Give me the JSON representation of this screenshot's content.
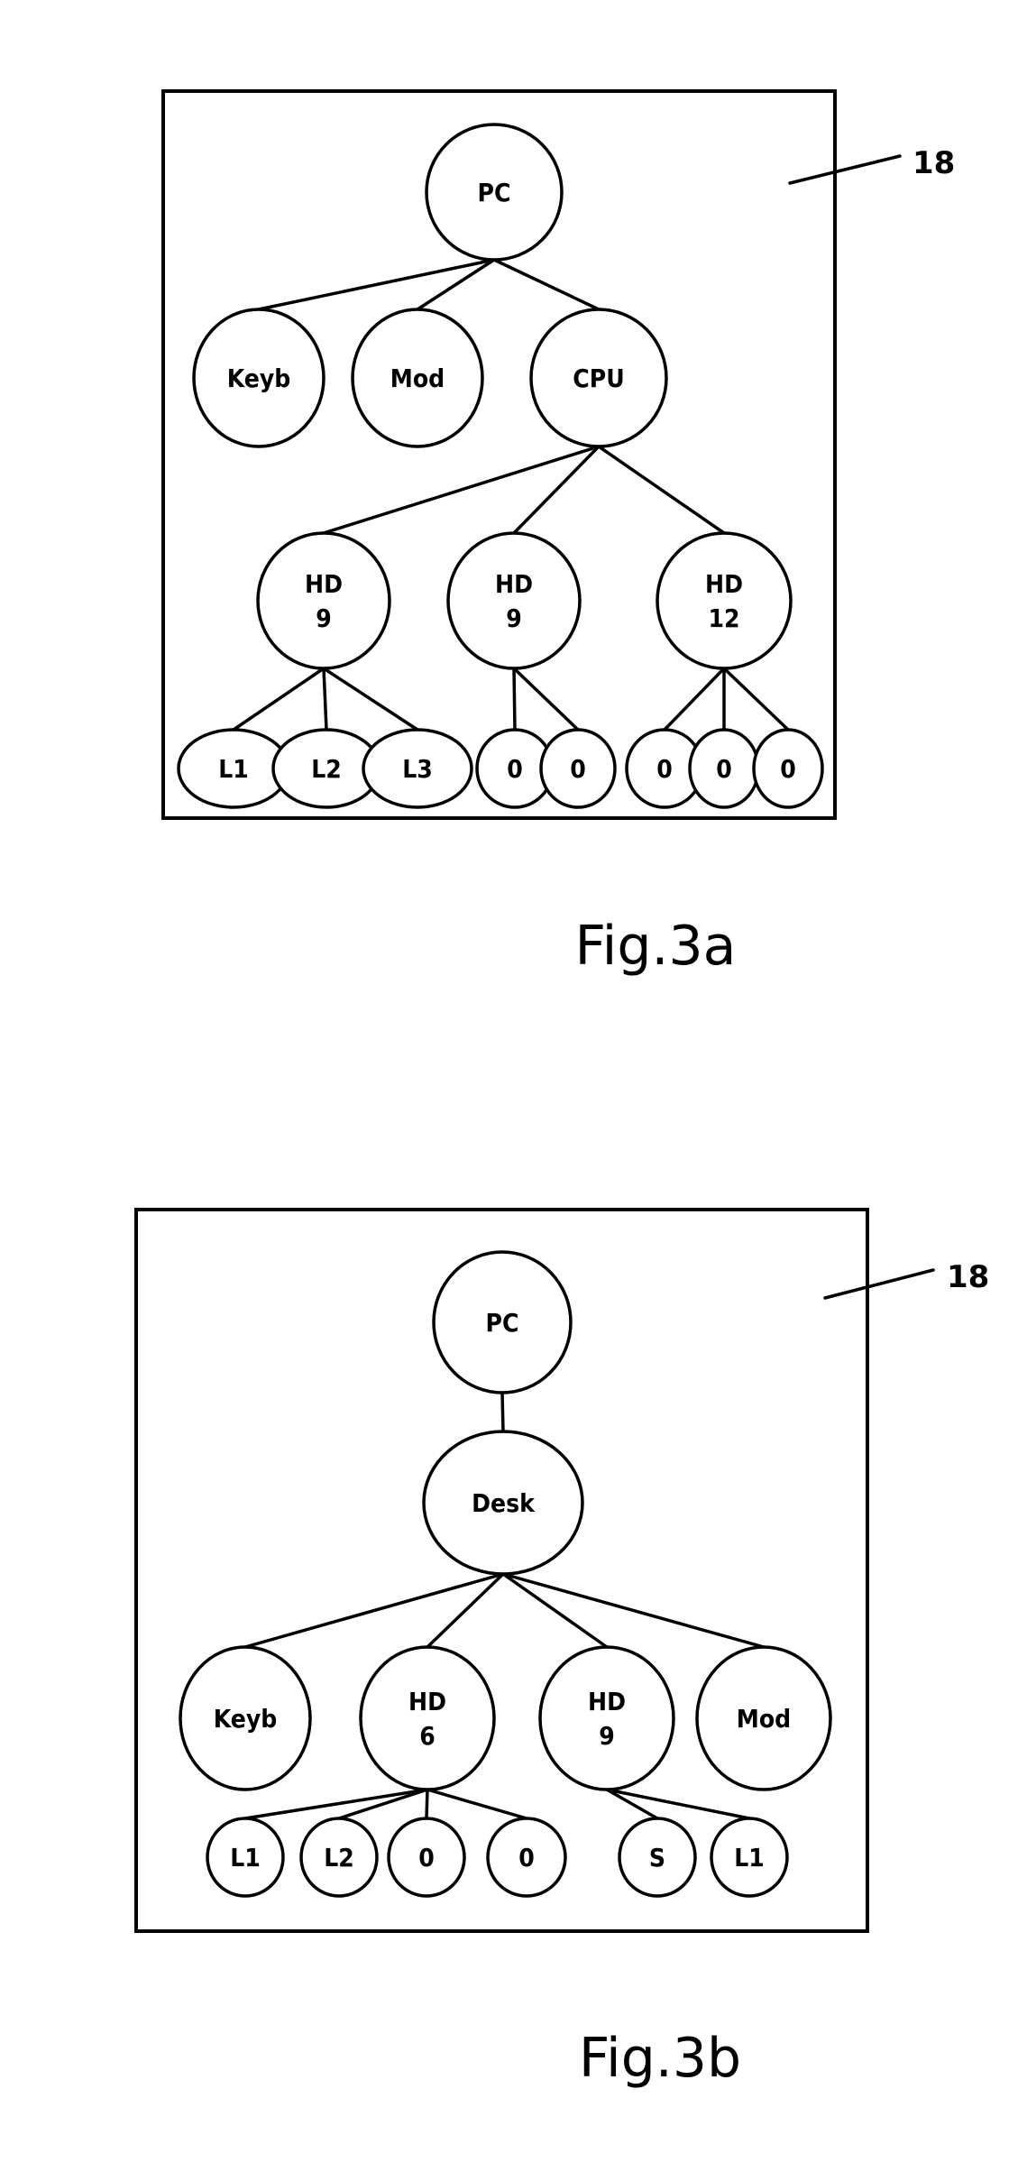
{
  "figures": [
    {
      "id": "fig3a",
      "caption": "Fig.3a",
      "reference_numeral": "18",
      "nodes": [
        {
          "id": "pc",
          "lines": [
            "PC"
          ],
          "parent": null
        },
        {
          "id": "keyb",
          "lines": [
            "Keyb"
          ],
          "parent": "pc"
        },
        {
          "id": "mod",
          "lines": [
            "Mod"
          ],
          "parent": "pc"
        },
        {
          "id": "cpu",
          "lines": [
            "CPU"
          ],
          "parent": "pc"
        },
        {
          "id": "hd1",
          "lines": [
            "HD",
            "9"
          ],
          "parent": "cpu"
        },
        {
          "id": "hd2",
          "lines": [
            "HD",
            "9"
          ],
          "parent": "cpu"
        },
        {
          "id": "hd3",
          "lines": [
            "HD",
            "12"
          ],
          "parent": "cpu"
        },
        {
          "id": "hd1-l1",
          "lines": [
            "L1"
          ],
          "parent": "hd1"
        },
        {
          "id": "hd1-l2",
          "lines": [
            "L2"
          ],
          "parent": "hd1"
        },
        {
          "id": "hd1-l3",
          "lines": [
            "L3"
          ],
          "parent": "hd1"
        },
        {
          "id": "hd2-o1",
          "lines": [
            "0"
          ],
          "parent": "hd2"
        },
        {
          "id": "hd2-o2",
          "lines": [
            "0"
          ],
          "parent": "hd2"
        },
        {
          "id": "hd3-o1",
          "lines": [
            "0"
          ],
          "parent": "hd3"
        },
        {
          "id": "hd3-o2",
          "lines": [
            "0"
          ],
          "parent": "hd3"
        },
        {
          "id": "hd3-o3",
          "lines": [
            "0"
          ],
          "parent": "hd3"
        }
      ]
    },
    {
      "id": "fig3b",
      "caption": "Fig.3b",
      "reference_numeral": "18",
      "nodes": [
        {
          "id": "pc",
          "lines": [
            "PC"
          ],
          "parent": null
        },
        {
          "id": "desk",
          "lines": [
            "Desk"
          ],
          "parent": "pc"
        },
        {
          "id": "keyb",
          "lines": [
            "Keyb"
          ],
          "parent": "desk"
        },
        {
          "id": "hd1",
          "lines": [
            "HD",
            "6"
          ],
          "parent": "desk"
        },
        {
          "id": "hd2",
          "lines": [
            "HD",
            "9"
          ],
          "parent": "desk"
        },
        {
          "id": "mod",
          "lines": [
            "Mod"
          ],
          "parent": "desk"
        },
        {
          "id": "hd1-l1",
          "lines": [
            "L1"
          ],
          "parent": "hd1"
        },
        {
          "id": "hd1-l2",
          "lines": [
            "L2"
          ],
          "parent": "hd1"
        },
        {
          "id": "hd1-o1",
          "lines": [
            "0"
          ],
          "parent": "hd1"
        },
        {
          "id": "hd1-o2",
          "lines": [
            "0"
          ],
          "parent": "hd1"
        },
        {
          "id": "hd2-s",
          "lines": [
            "S"
          ],
          "parent": "hd2"
        },
        {
          "id": "hd2-l1",
          "lines": [
            "L1"
          ],
          "parent": "hd2"
        }
      ]
    }
  ]
}
